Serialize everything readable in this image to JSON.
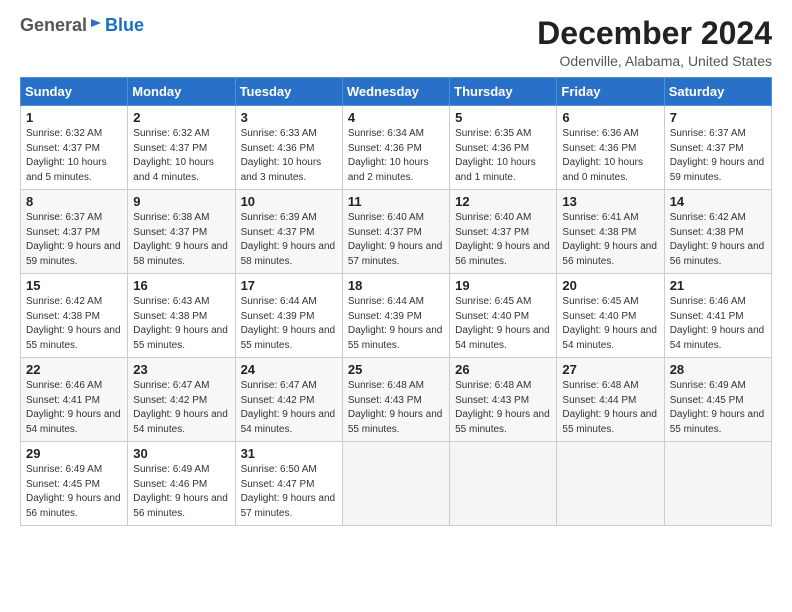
{
  "header": {
    "logo_general": "General",
    "logo_blue": "Blue",
    "month_title": "December 2024",
    "location": "Odenville, Alabama, United States"
  },
  "days_of_week": [
    "Sunday",
    "Monday",
    "Tuesday",
    "Wednesday",
    "Thursday",
    "Friday",
    "Saturday"
  ],
  "weeks": [
    [
      {
        "day": "1",
        "sunrise": "6:32 AM",
        "sunset": "4:37 PM",
        "daylight": "10 hours and 5 minutes."
      },
      {
        "day": "2",
        "sunrise": "6:32 AM",
        "sunset": "4:37 PM",
        "daylight": "10 hours and 4 minutes."
      },
      {
        "day": "3",
        "sunrise": "6:33 AM",
        "sunset": "4:36 PM",
        "daylight": "10 hours and 3 minutes."
      },
      {
        "day": "4",
        "sunrise": "6:34 AM",
        "sunset": "4:36 PM",
        "daylight": "10 hours and 2 minutes."
      },
      {
        "day": "5",
        "sunrise": "6:35 AM",
        "sunset": "4:36 PM",
        "daylight": "10 hours and 1 minute."
      },
      {
        "day": "6",
        "sunrise": "6:36 AM",
        "sunset": "4:36 PM",
        "daylight": "10 hours and 0 minutes."
      },
      {
        "day": "7",
        "sunrise": "6:37 AM",
        "sunset": "4:37 PM",
        "daylight": "9 hours and 59 minutes."
      }
    ],
    [
      {
        "day": "8",
        "sunrise": "6:37 AM",
        "sunset": "4:37 PM",
        "daylight": "9 hours and 59 minutes."
      },
      {
        "day": "9",
        "sunrise": "6:38 AM",
        "sunset": "4:37 PM",
        "daylight": "9 hours and 58 minutes."
      },
      {
        "day": "10",
        "sunrise": "6:39 AM",
        "sunset": "4:37 PM",
        "daylight": "9 hours and 58 minutes."
      },
      {
        "day": "11",
        "sunrise": "6:40 AM",
        "sunset": "4:37 PM",
        "daylight": "9 hours and 57 minutes."
      },
      {
        "day": "12",
        "sunrise": "6:40 AM",
        "sunset": "4:37 PM",
        "daylight": "9 hours and 56 minutes."
      },
      {
        "day": "13",
        "sunrise": "6:41 AM",
        "sunset": "4:38 PM",
        "daylight": "9 hours and 56 minutes."
      },
      {
        "day": "14",
        "sunrise": "6:42 AM",
        "sunset": "4:38 PM",
        "daylight": "9 hours and 56 minutes."
      }
    ],
    [
      {
        "day": "15",
        "sunrise": "6:42 AM",
        "sunset": "4:38 PM",
        "daylight": "9 hours and 55 minutes."
      },
      {
        "day": "16",
        "sunrise": "6:43 AM",
        "sunset": "4:38 PM",
        "daylight": "9 hours and 55 minutes."
      },
      {
        "day": "17",
        "sunrise": "6:44 AM",
        "sunset": "4:39 PM",
        "daylight": "9 hours and 55 minutes."
      },
      {
        "day": "18",
        "sunrise": "6:44 AM",
        "sunset": "4:39 PM",
        "daylight": "9 hours and 55 minutes."
      },
      {
        "day": "19",
        "sunrise": "6:45 AM",
        "sunset": "4:40 PM",
        "daylight": "9 hours and 54 minutes."
      },
      {
        "day": "20",
        "sunrise": "6:45 AM",
        "sunset": "4:40 PM",
        "daylight": "9 hours and 54 minutes."
      },
      {
        "day": "21",
        "sunrise": "6:46 AM",
        "sunset": "4:41 PM",
        "daylight": "9 hours and 54 minutes."
      }
    ],
    [
      {
        "day": "22",
        "sunrise": "6:46 AM",
        "sunset": "4:41 PM",
        "daylight": "9 hours and 54 minutes."
      },
      {
        "day": "23",
        "sunrise": "6:47 AM",
        "sunset": "4:42 PM",
        "daylight": "9 hours and 54 minutes."
      },
      {
        "day": "24",
        "sunrise": "6:47 AM",
        "sunset": "4:42 PM",
        "daylight": "9 hours and 54 minutes."
      },
      {
        "day": "25",
        "sunrise": "6:48 AM",
        "sunset": "4:43 PM",
        "daylight": "9 hours and 55 minutes."
      },
      {
        "day": "26",
        "sunrise": "6:48 AM",
        "sunset": "4:43 PM",
        "daylight": "9 hours and 55 minutes."
      },
      {
        "day": "27",
        "sunrise": "6:48 AM",
        "sunset": "4:44 PM",
        "daylight": "9 hours and 55 minutes."
      },
      {
        "day": "28",
        "sunrise": "6:49 AM",
        "sunset": "4:45 PM",
        "daylight": "9 hours and 55 minutes."
      }
    ],
    [
      {
        "day": "29",
        "sunrise": "6:49 AM",
        "sunset": "4:45 PM",
        "daylight": "9 hours and 56 minutes."
      },
      {
        "day": "30",
        "sunrise": "6:49 AM",
        "sunset": "4:46 PM",
        "daylight": "9 hours and 56 minutes."
      },
      {
        "day": "31",
        "sunrise": "6:50 AM",
        "sunset": "4:47 PM",
        "daylight": "9 hours and 57 minutes."
      },
      null,
      null,
      null,
      null
    ]
  ]
}
